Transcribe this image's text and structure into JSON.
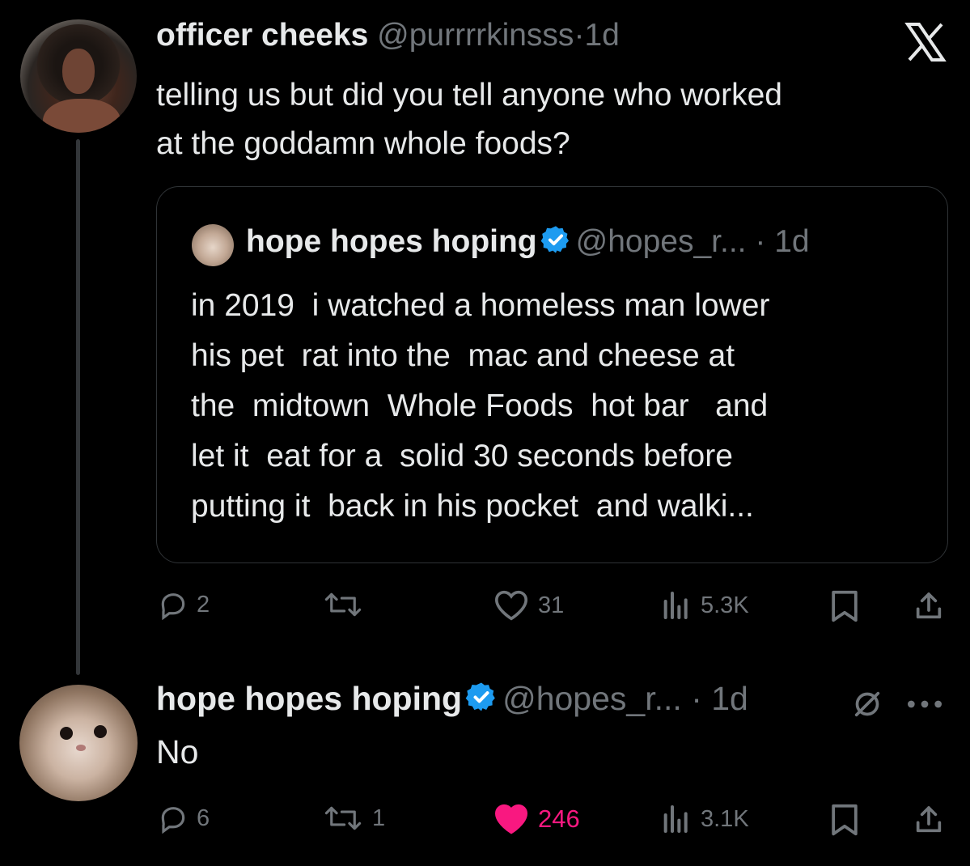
{
  "tweet1": {
    "display_name": "officer cheeks",
    "handle": "@purrrrkinsss",
    "separator": "·",
    "time": "1d",
    "body_line1": "telling us but did you tell anyone who worked",
    "body_line2": "at the goddamn whole foods?",
    "quote": {
      "display_name": "hope hopes hoping",
      "handle": "@hopes_r...",
      "separator": "·",
      "time": "1d",
      "body": "in 2019  i watched a homeless man lower\nhis pet  rat into the  mac and cheese at\nthe  midtown  Whole Foods  hot bar   and\nlet it  eat for a  solid 30 seconds before\nputting it  back in his pocket  and walki..."
    },
    "actions": {
      "replies": "2",
      "reposts": "",
      "likes": "31",
      "views": "5.3K"
    }
  },
  "tweet2": {
    "display_name": "hope hopes hoping",
    "handle": "@hopes_r...",
    "separator": "·",
    "time": "1d",
    "body": "No",
    "actions": {
      "replies": "6",
      "reposts": "1",
      "likes": "246",
      "views": "3.1K"
    }
  },
  "colors": {
    "background": "#000000",
    "text": "#e7e9ea",
    "muted": "#71767b",
    "verified": "#1d9bf0",
    "like": "#f91880",
    "border": "#2f3336"
  },
  "icons": [
    "x-logo-icon",
    "verified-badge-icon",
    "reply-icon",
    "repost-icon",
    "like-icon",
    "views-icon",
    "bookmark-icon",
    "share-icon",
    "mute-icon",
    "more-icon"
  ]
}
